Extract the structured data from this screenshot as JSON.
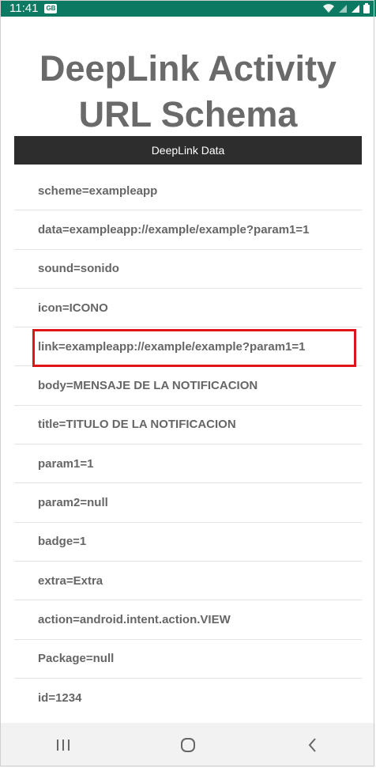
{
  "status_bar": {
    "time": "11:41",
    "notification_badge": "GB",
    "icons": [
      "wifi-icon",
      "signal-icon",
      "signal-icon",
      "battery-icon"
    ]
  },
  "header": {
    "title_line1": "DeepLink Activity",
    "title_line2": "URL Schema"
  },
  "section": {
    "label": "DeepLink Data"
  },
  "items": [
    {
      "text": "scheme=exampleapp"
    },
    {
      "text": "data=exampleapp://example/example?param1=1"
    },
    {
      "text": "sound=sonido"
    },
    {
      "text": "icon=ICONO"
    },
    {
      "text": "link=exampleapp://example/example?param1=1",
      "highlighted": true
    },
    {
      "text": "body=MENSAJE DE LA NOTIFICACION"
    },
    {
      "text": "title=TITULO DE LA NOTIFICACION"
    },
    {
      "text": "param1=1"
    },
    {
      "text": "param2=null"
    },
    {
      "text": "badge=1"
    },
    {
      "text": "extra=Extra"
    },
    {
      "text": "action=android.intent.action.VIEW"
    },
    {
      "text": "Package=null"
    },
    {
      "text": "id=1234"
    }
  ],
  "nav_bar": {
    "buttons": [
      "recents-icon",
      "home-icon",
      "back-icon"
    ]
  },
  "colors": {
    "status_bar": "#0c7a62",
    "title": "#6a6a6a",
    "section_bar": "#2d2d2d",
    "highlight": "#e0131a"
  }
}
